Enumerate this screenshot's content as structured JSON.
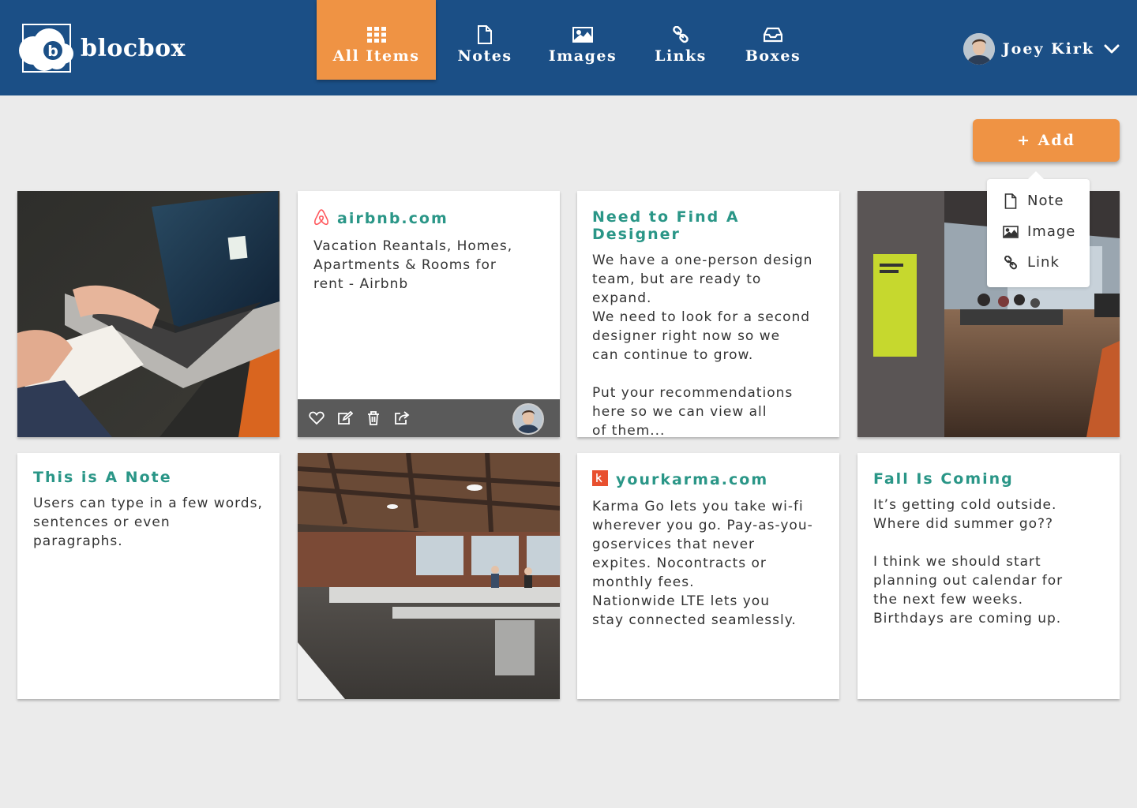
{
  "app": {
    "name": "blocbox"
  },
  "nav": {
    "items": [
      {
        "label": "All Items",
        "icon": "grid-icon",
        "active": true
      },
      {
        "label": "Notes",
        "icon": "document-icon",
        "active": false
      },
      {
        "label": "Images",
        "icon": "image-icon",
        "active": false
      },
      {
        "label": "Links",
        "icon": "link-icon",
        "active": false
      },
      {
        "label": "Boxes",
        "icon": "inbox-icon",
        "active": false
      }
    ]
  },
  "user": {
    "name": "Joey Kirk"
  },
  "add_button": {
    "label": "+ Add"
  },
  "add_menu": {
    "items": [
      {
        "label": "Note",
        "icon": "document-icon"
      },
      {
        "label": "Image",
        "icon": "image-icon"
      },
      {
        "label": "Link",
        "icon": "link-icon"
      }
    ]
  },
  "cards": {
    "airbnb": {
      "title": "airbnb.com",
      "body": "Vacation Reantals, Homes,\nApartments & Rooms for\nrent - Airbnb",
      "icon": "airbnb-logo"
    },
    "designer": {
      "title": "Need to Find A Designer",
      "body": "We have a one-person design\nteam, but are ready to expand.\nWe need to look for a second\ndesigner right now so we\ncan continue to grow.\n\nPut your recommendations\nhere so we can view all\nof them..."
    },
    "note": {
      "title": "This is A Note",
      "body": "Users can type in a few words,\nsentences or even paragraphs."
    },
    "karma": {
      "title": "yourkarma.com",
      "body": "Karma Go lets you take wi-fi\nwherever you go. Pay-as-you-\ngoservices that never\nexpites. Nocontracts or\nmonthly fees.\nNationwide LTE lets you\nstay connected seamlessly.",
      "icon": "karma-logo"
    },
    "fall": {
      "title": "Fall Is Coming",
      "body": "It’s getting cold outside.\nWhere did summer go??\n\nI think we should start\nplanning out calendar for\nthe next few weeks.\nBirthdays are coming up."
    }
  },
  "colors": {
    "header": "#1b4f86",
    "accent": "#ef9344",
    "title": "#2a9687",
    "background": "#ebebeb"
  }
}
